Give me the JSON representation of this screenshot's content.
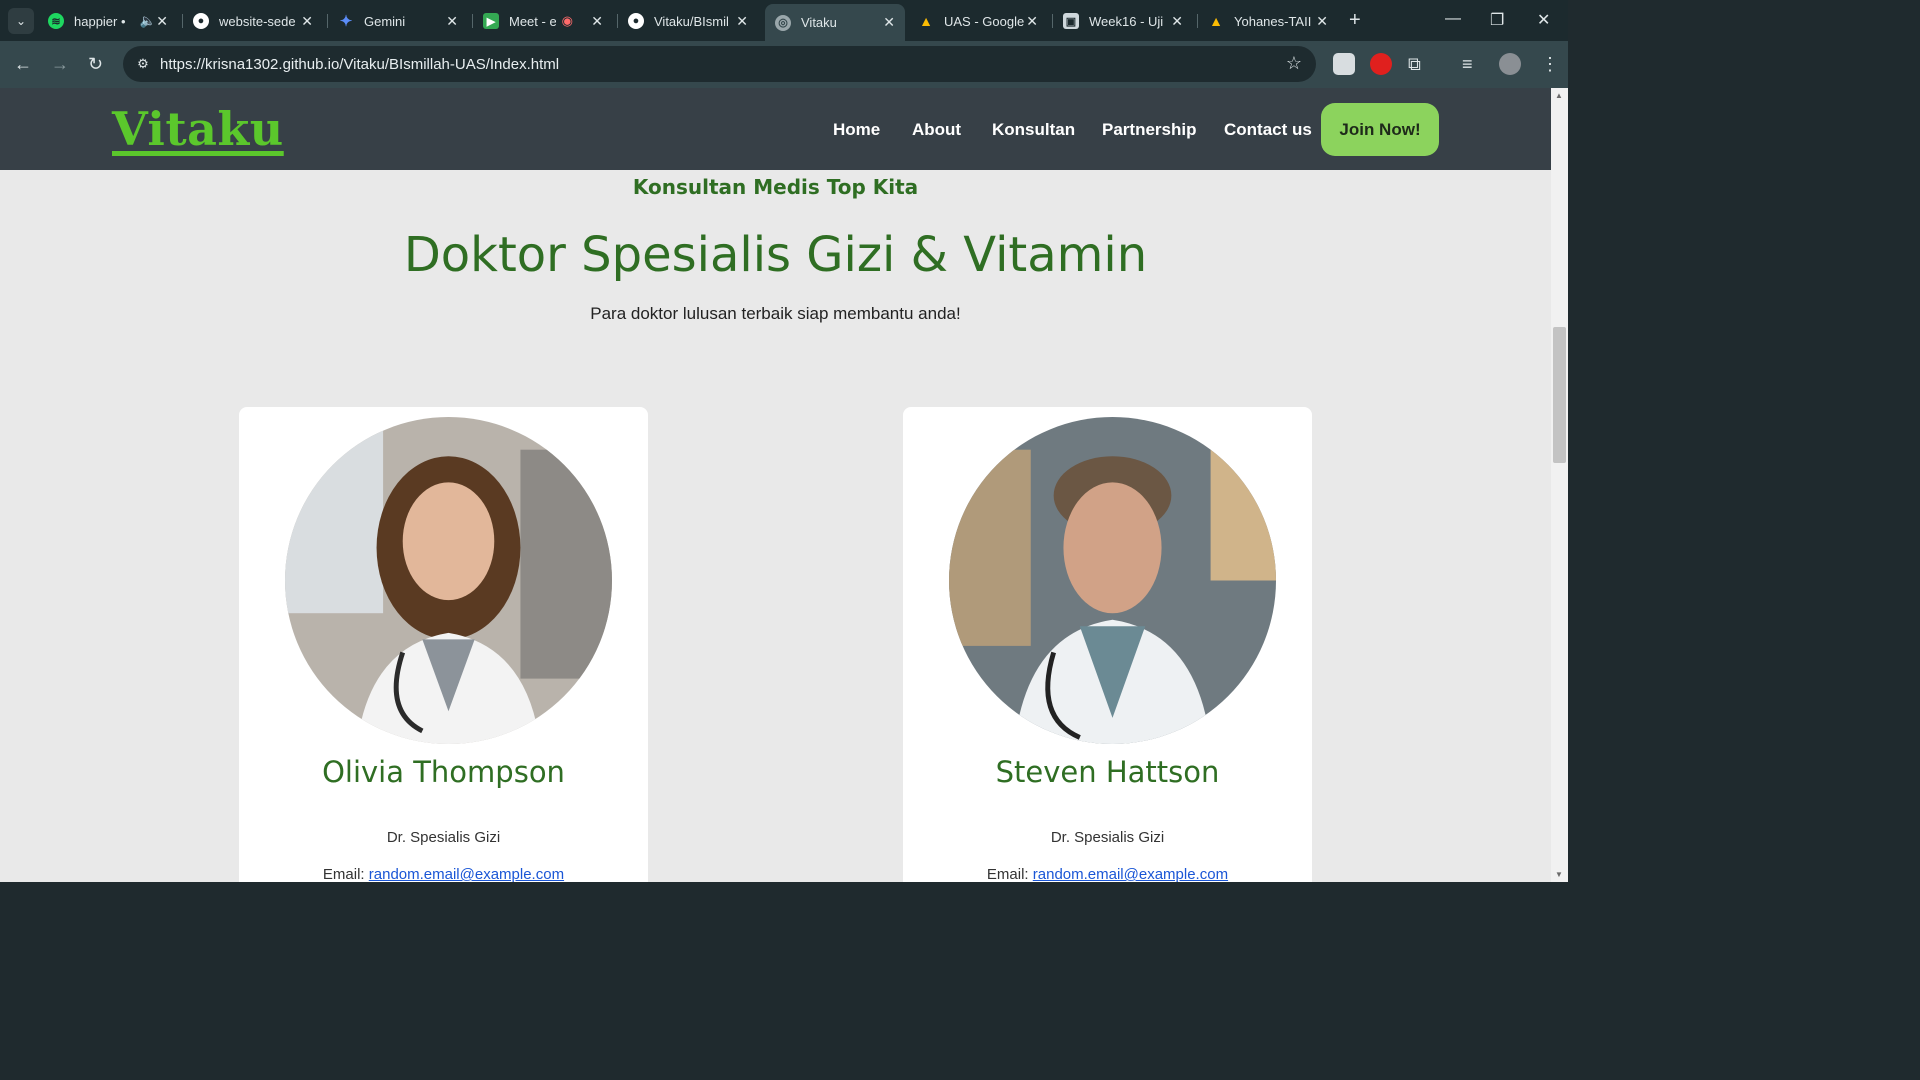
{
  "browser": {
    "tabs": [
      {
        "title": "happier •",
        "icon": "spotify-icon",
        "color": "#1ed760"
      },
      {
        "title": "website-sede",
        "icon": "github-icon",
        "color": "#ffffff"
      },
      {
        "title": "Gemini",
        "icon": "gemini-icon",
        "color": "#5b8cf7"
      },
      {
        "title": "Meet - ex",
        "icon": "meet-icon",
        "color": "#34a853"
      },
      {
        "title": "Vitaku/BIsmil",
        "icon": "github-icon",
        "color": "#ffffff"
      },
      {
        "title": "Vitaku",
        "icon": "globe-icon",
        "color": "#9aa7ab"
      },
      {
        "title": "UAS - Google",
        "icon": "drive-icon",
        "color": "#fbbc04"
      },
      {
        "title": "Week16 - Uji",
        "icon": "classroom-icon",
        "color": "#cfd8dc"
      },
      {
        "title": "Yohanes-TAII",
        "icon": "drive-icon",
        "color": "#fbbc04"
      }
    ],
    "url": "https://krisna1302.github.io/Vitaku/BIsmillah-UAS/Index.html"
  },
  "site": {
    "logo": "Vitaku",
    "nav": [
      "Home",
      "About",
      "Konsultan",
      "Partnership",
      "Contact us"
    ],
    "cta": "Join Now!",
    "colors": {
      "brand": "#5bc72c",
      "header": "#374047",
      "accent": "#2f6e23",
      "cta": "#8cd35d"
    }
  },
  "section": {
    "eyebrow": "Konsultan Medis Top Kita",
    "title": "Doktor Spesialis Gizi & Vitamin",
    "subtitle": "Para doktor lulusan terbaik siap membantu anda!"
  },
  "doctors": [
    {
      "name": "Olivia Thompson",
      "role": "Dr. Spesialis Gizi",
      "email_label": "Email:",
      "email": "random.email@example.com"
    },
    {
      "name": "Steven Hattson",
      "role": "Dr. Spesialis Gizi",
      "email_label": "Email:",
      "email": "random.email@example.com"
    }
  ]
}
